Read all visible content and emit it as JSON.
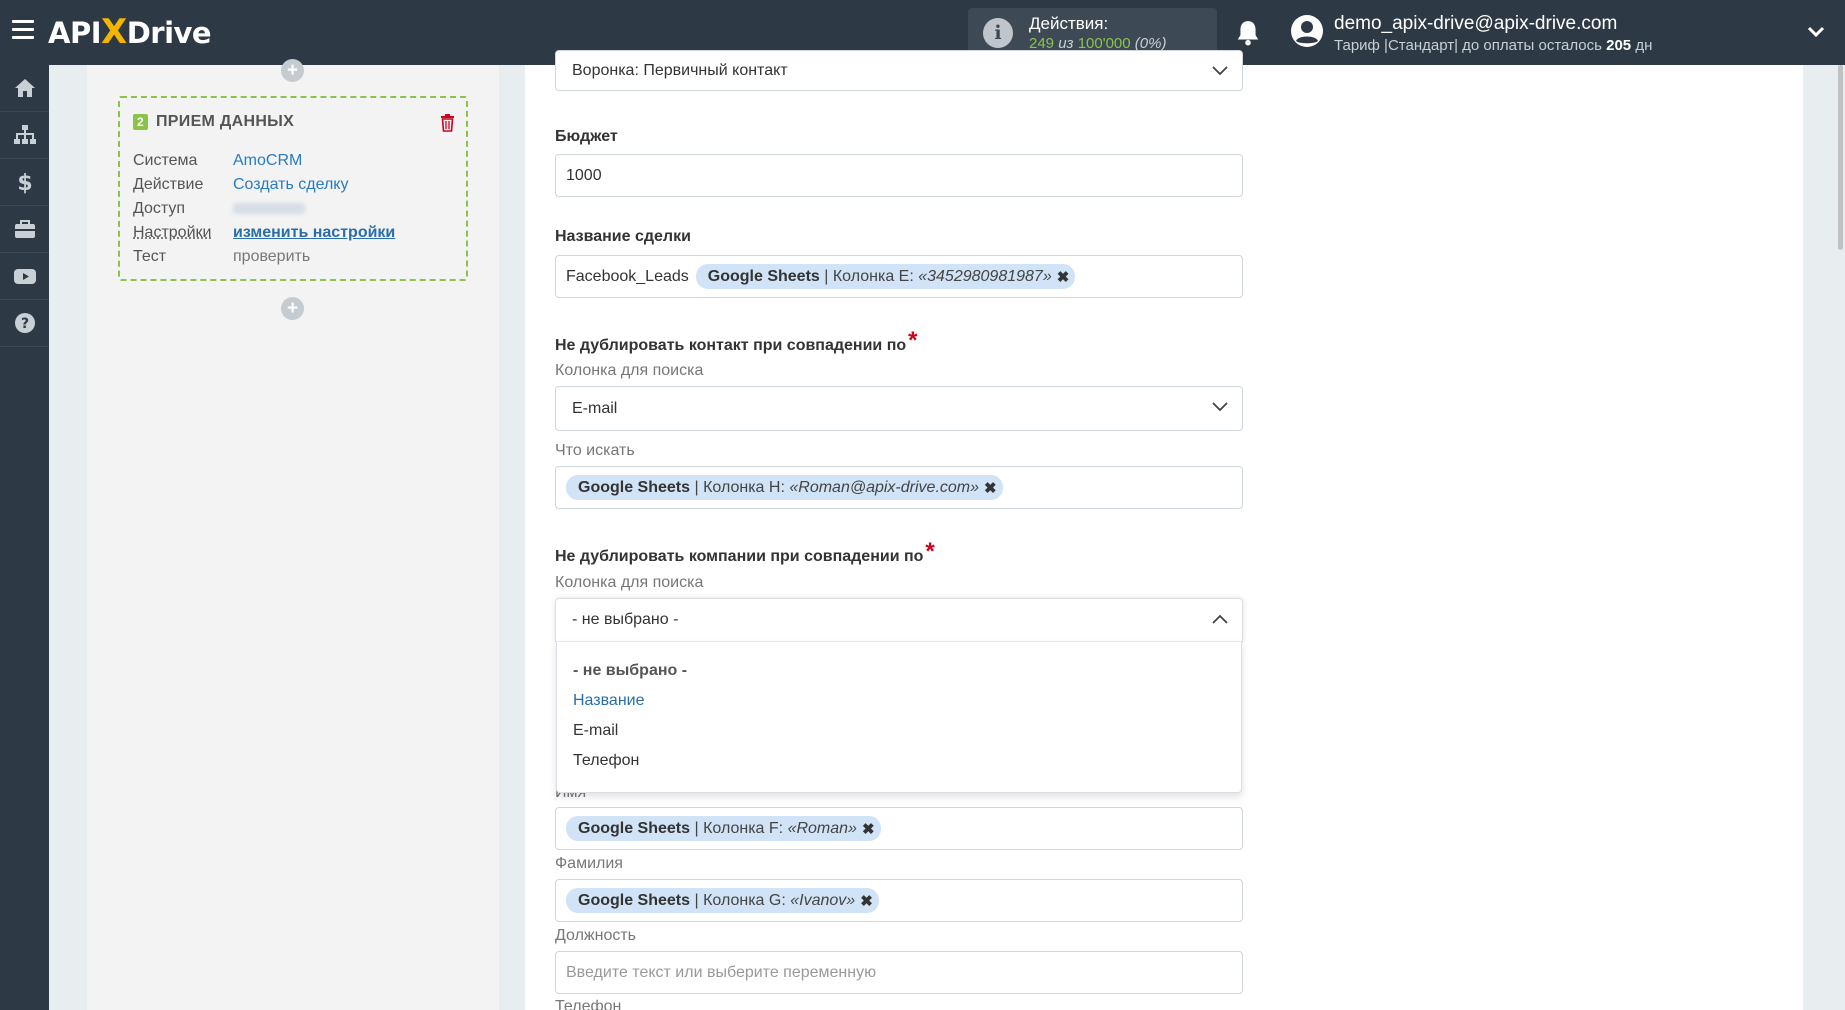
{
  "app": {
    "logo_api": "API",
    "logo_x": "X",
    "logo_drive": "Drive"
  },
  "header": {
    "actions_label": "Действия:",
    "actions_used": "249",
    "actions_of": "из",
    "actions_total": "100'000",
    "actions_percent": "(0%)",
    "user_email": "demo_apix-drive@apix-drive.com",
    "plan_text": "Тариф |Стандарт| до оплаты осталось",
    "plan_days": "205",
    "plan_days_unit": "дн"
  },
  "sidebar": {
    "items": [
      "home-icon",
      "sitemap-icon",
      "dollar-icon",
      "briefcase-icon",
      "youtube-icon",
      "help-icon"
    ]
  },
  "card": {
    "number": "2",
    "title": "ПРИЕМ ДАННЫХ",
    "rows": [
      {
        "key": "Система",
        "value": "AmoCRM"
      },
      {
        "key": "Действие",
        "value": "Создать сделку"
      },
      {
        "key": "Доступ",
        "value": ""
      },
      {
        "key": "Настройки",
        "value": "изменить настройки"
      },
      {
        "key": "Тест",
        "value": "проверить"
      }
    ]
  },
  "form": {
    "funnel_value": "Воронка: Первичный контакт",
    "budget_label": "Бюджет",
    "budget_value": "1000",
    "deal_name_label": "Название сделки",
    "deal_name_text": "Facebook_Leads",
    "deal_name_tag": {
      "source": "Google Sheets",
      "column": "| Колонка E:",
      "value": "«3452980981987»"
    },
    "dup_contact_label": "Не дублировать контакт при совпадении по",
    "search_column_label": "Колонка для поиска",
    "dup_contact_column": "E-mail",
    "what_search_label": "Что искать",
    "dup_contact_tag": {
      "source": "Google Sheets",
      "column": "| Колонка H:",
      "value": "«Roman@apix-drive.com»"
    },
    "dup_company_label": "Не дублировать компании при совпадении по",
    "dup_company_search_label": "Колонка для поиска",
    "dup_company_value": "- не выбрано -",
    "dropdown_options": [
      "- не выбрано -",
      "Название",
      "E-mail",
      "Телефон"
    ],
    "name_label": "Имя",
    "name_tag": {
      "source": "Google Sheets",
      "column": "| Колонка F:",
      "value": "«Roman»"
    },
    "surname_label": "Фамилия",
    "surname_tag": {
      "source": "Google Sheets",
      "column": "| Колонка G:",
      "value": "«Ivanov»"
    },
    "position_label": "Должность",
    "position_placeholder": "Введите текст или выберите переменную",
    "phone_label": "Телефон"
  },
  "colors": {
    "topbar": "#2d3a45",
    "accent_green": "#8bc34a",
    "link_blue": "#2a7bbf",
    "tag_bg": "#d1e3f6",
    "required_red": "#d0021b"
  }
}
